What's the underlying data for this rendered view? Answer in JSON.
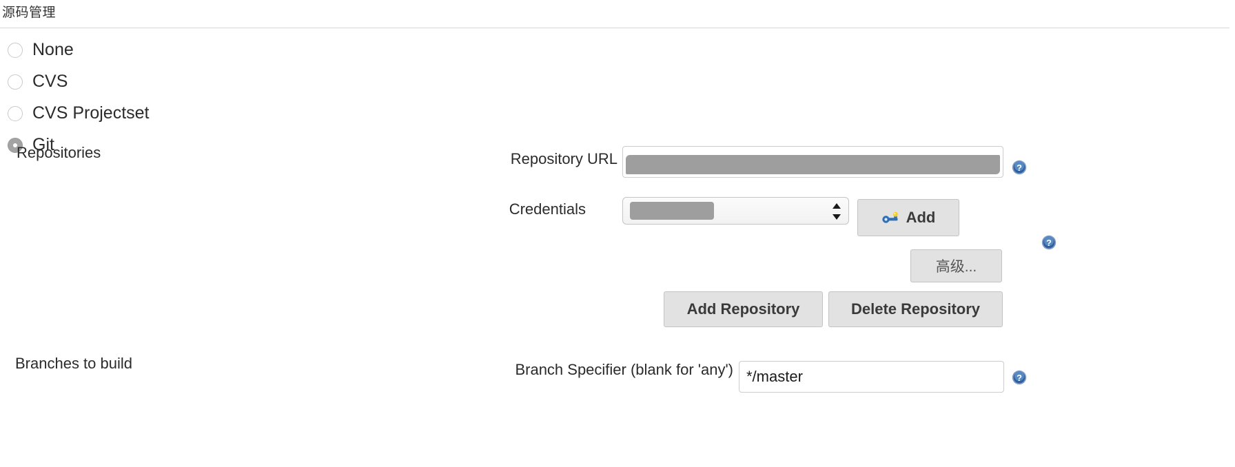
{
  "section": {
    "title": "源码管理"
  },
  "scm_options": [
    {
      "label": "None",
      "selected": false
    },
    {
      "label": "CVS",
      "selected": false
    },
    {
      "label": "CVS Projectset",
      "selected": false
    },
    {
      "label": "Git",
      "selected": true
    }
  ],
  "repositories": {
    "caption": "Repositories",
    "repository_url": {
      "label": "Repository URL",
      "value": "",
      "redacted": true
    },
    "credentials": {
      "label": "Credentials",
      "selected_value": "",
      "redacted": true
    },
    "add_credential_button": {
      "label": "Add",
      "icon": "key-icon"
    },
    "advanced_button": {
      "label": "高级..."
    },
    "add_repository_button": {
      "label": "Add Repository"
    },
    "delete_repository_button": {
      "label": "Delete Repository"
    }
  },
  "branches": {
    "caption": "Branches to build",
    "branch_specifier": {
      "label": "Branch Specifier (blank for 'any')",
      "value": "*/master"
    }
  },
  "help_icons": {
    "repository_url": "help-icon",
    "advanced": "help-icon",
    "branch_specifier": "help-icon"
  },
  "colors": {
    "page_background": "#ffffff",
    "text": "#2b2b2b",
    "divider": "#d8d8d8",
    "button_face": "#e2e2e2",
    "button_border": "#c3c3c3",
    "input_border": "#cccccc",
    "radio_selected": "#a3a3a3",
    "redaction": "#9e9e9e",
    "help_blue": "#2b6cb0"
  }
}
